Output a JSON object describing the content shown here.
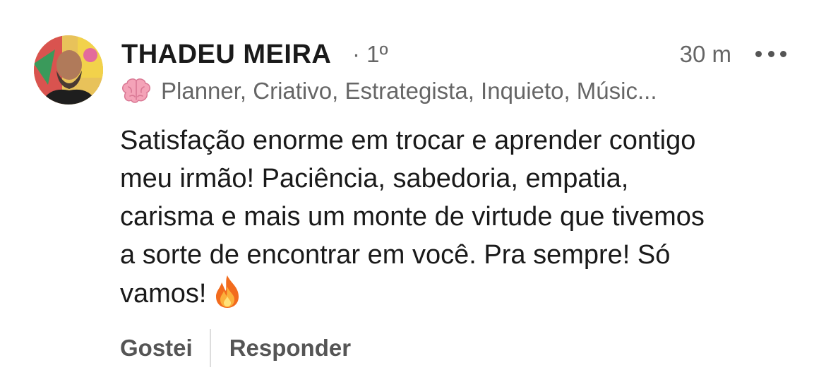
{
  "comment": {
    "author": "THADEU MEIRA",
    "degree": "· 1º",
    "timestamp": "30 m",
    "headline_icon": "brain-icon",
    "headline": "Planner, Criativo, Estrategista, Inquieto, Músic...",
    "body_lines": [
      "Satisfação enorme em trocar e aprender contigo",
      "meu irmão! Paciência, sabedoria, empatia,",
      "carisma e mais um monte de virtude que tivemos",
      "a sorte de encontrar em você. Pra sempre! Só",
      "vamos!"
    ],
    "body_emoji": "fire-icon",
    "actions": {
      "like_label": "Gostei",
      "reply_label": "Responder"
    }
  },
  "colors": {
    "text_primary": "#1a1a1a",
    "text_secondary": "#666666",
    "action_text": "#555555"
  }
}
